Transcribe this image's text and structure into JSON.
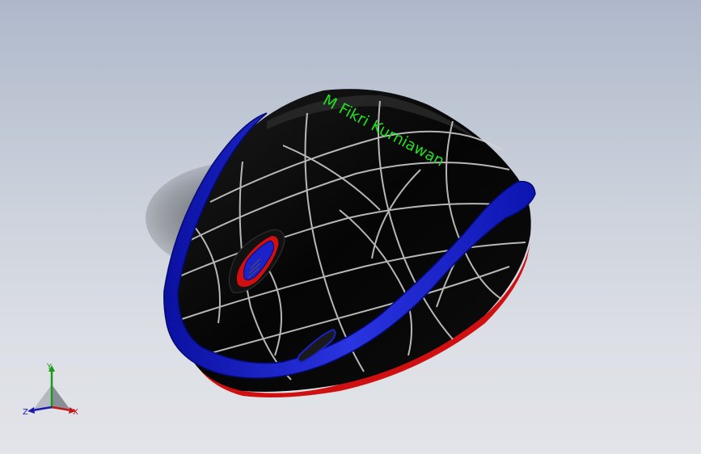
{
  "model": {
    "engraved_text": "M Fikri Kurniawan",
    "colors": {
      "background_top": "#aeb8ca",
      "background_bottom": "#e2e4e8",
      "shell": "#0a0a0a",
      "trim": "#1a22c8",
      "accent": "#d01010",
      "text": "#22dd22"
    }
  },
  "triad": {
    "x_label": "X",
    "y_label": "Y",
    "z_label": "Z",
    "colors": {
      "x": "#c01818",
      "y": "#1a9a1a",
      "z": "#1a1ab0"
    }
  }
}
